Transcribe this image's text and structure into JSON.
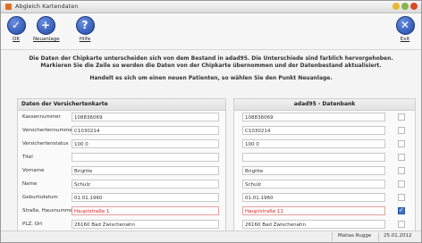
{
  "window": {
    "title": "Abgleich Kartendaten",
    "controls": {
      "minimize_color": "#e8b930",
      "maximize_color": "#8ab34a",
      "close_color": "#d84a2a"
    }
  },
  "toolbar": {
    "ok_label": "OK",
    "new_label": "Neuanlage",
    "help_label": "Hilfe",
    "exit_label": "Exit"
  },
  "message": {
    "line1": "Die Daten der Chipkarte unterscheiden sich von dem Bestand in adad95. Die Unterschiede sind farblich hervorgehoben.",
    "line2": "Markieren Sie die Zeile so werden die Daten von der Chipkarte übernommen und der Datenbestand aktualisiert.",
    "line3": "Handelt es sich um einen neuen Patienten, so wählen Sie den Punkt Neuanlage."
  },
  "left_panel": {
    "header": "Daten der Versichertenkarte",
    "rows": [
      {
        "label": "Kassennummer",
        "value": "108836069"
      },
      {
        "label": "Versichertennummer",
        "value": "C1030214"
      },
      {
        "label": "Versichertenstatus",
        "value": "100 0"
      },
      {
        "label": "Titel",
        "value": ""
      },
      {
        "label": "Vorname",
        "value": "Brigitte"
      },
      {
        "label": "Name",
        "value": "Schulz"
      },
      {
        "label": "Geburtsdatum",
        "value": "01.01.1960"
      },
      {
        "label": "Straße, Hausnummer",
        "value": "Hauptstraße 1"
      },
      {
        "label": "PLZ, Ort",
        "value": "26160 Bad Zwischenahn"
      }
    ]
  },
  "right_panel": {
    "header": "adad95 - Datenbank",
    "rows": [
      {
        "value": "108836069"
      },
      {
        "value": "C1030214"
      },
      {
        "value": "100 0"
      },
      {
        "value": ""
      },
      {
        "value": "Brigitte"
      },
      {
        "value": "Schulz"
      },
      {
        "value": "01.01.1960"
      },
      {
        "value": "Hauptstraße 11"
      },
      {
        "value": "26160 Bad Zwischenahn"
      }
    ],
    "checked_rows": [
      7
    ]
  },
  "statusbar": {
    "user": "Matias Rugge",
    "date": "25.01.2012"
  },
  "colors": {
    "accent": "#1f4aa8",
    "diff_red": "#d22222",
    "app_icon": "#e07020"
  }
}
